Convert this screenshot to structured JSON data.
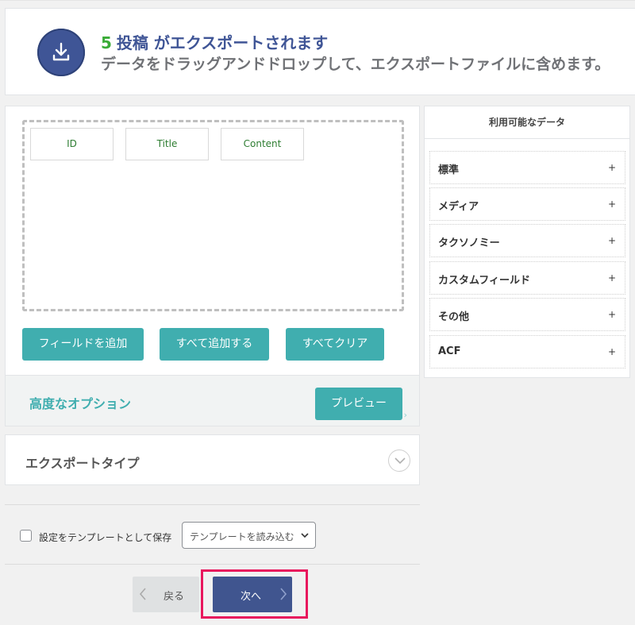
{
  "header": {
    "count": "5",
    "title": "投稿 がエクスポートされます",
    "subtitle": "データをドラッグアンドドロップして、エクスポートファイルに含めます。",
    "icon": "download-icon"
  },
  "builder": {
    "fields": [
      "ID",
      "Title",
      "Content"
    ],
    "buttons": {
      "add_field": "フィールドを追加",
      "add_all": "すべて追加する",
      "clear_all": "すべてクリア"
    },
    "advanced_label": "高度なオプション",
    "preview_label": "プレビュー"
  },
  "available": {
    "title": "利用可能なデータ",
    "items": [
      "標準",
      "メディア",
      "タクソノミー",
      "カスタムフィールド",
      "その他",
      "ACF"
    ],
    "expand_symbol": "+"
  },
  "export_type": {
    "label": "エクスポートタイプ"
  },
  "settings": {
    "save_template_label": "設定をテンプレートとして保存",
    "save_template_checked": false,
    "load_template_value": "テンプレートを読み込む"
  },
  "nav": {
    "back_label": "戻る",
    "next_label": "次へ"
  },
  "colors": {
    "accent_teal": "#40aeaf",
    "brand_blue": "#3f5596",
    "count_green": "#3aab37",
    "highlight_pink": "#e8175d"
  }
}
